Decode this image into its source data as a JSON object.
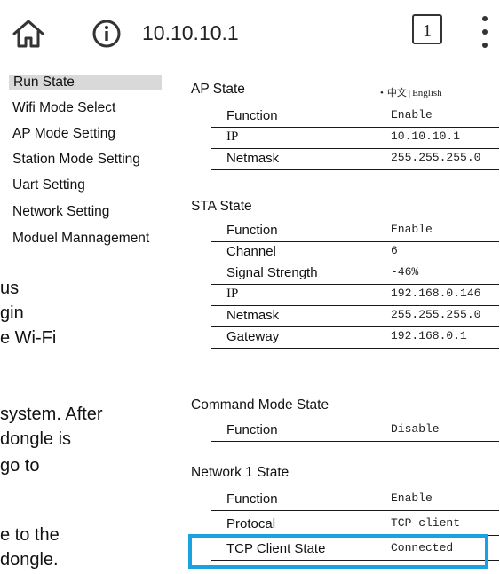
{
  "browser": {
    "url": "10.10.10.1",
    "tab_count": "1",
    "home_icon": "home-icon",
    "info_icon": "info-circle-icon",
    "menu_icon": "more-vertical-icon"
  },
  "lang": {
    "bullet": "•",
    "chinese": "中文",
    "separator": "|",
    "english": "English"
  },
  "sidebar": {
    "items": [
      {
        "label": "Run State"
      },
      {
        "label": "Wifi Mode Select"
      },
      {
        "label": "AP Mode Setting"
      },
      {
        "label": "Station Mode Setting"
      },
      {
        "label": "Uart Setting"
      },
      {
        "label": "Network Setting"
      },
      {
        "label": "Moduel Mannagement"
      }
    ]
  },
  "background_text": {
    "lines": [
      "us",
      "gin",
      "e Wi-Fi",
      "system. After",
      "dongle is",
      "go to",
      "e to the",
      "dongle."
    ]
  },
  "ap_state": {
    "title": "AP State",
    "rows": [
      {
        "key": "Function",
        "value": "Enable"
      },
      {
        "key": "IP",
        "value": "10.10.10.1"
      },
      {
        "key": "Netmask",
        "value": "255.255.255.0"
      }
    ]
  },
  "sta_state": {
    "title": "STA State",
    "rows": [
      {
        "key": "Function",
        "value": "Enable"
      },
      {
        "key": "Channel",
        "value": "6"
      },
      {
        "key": "Signal Strength",
        "value": "-46%"
      },
      {
        "key": "IP",
        "value": "192.168.0.146"
      },
      {
        "key": "Netmask",
        "value": "255.255.255.0"
      },
      {
        "key": "Gateway",
        "value": "192.168.0.1"
      }
    ]
  },
  "command_state": {
    "title": "Command Mode State",
    "rows": [
      {
        "key": "Function",
        "value": "Disable"
      }
    ]
  },
  "network1_state": {
    "title": "Network 1 State",
    "rows": [
      {
        "key": "Function",
        "value": "Enable"
      },
      {
        "key": "Protocal",
        "value": "TCP client"
      },
      {
        "key": "TCP Client State",
        "value": "Connected"
      }
    ]
  },
  "colors": {
    "highlight": "#1aa1e0",
    "active_menu_bg": "#d9d9d9"
  }
}
